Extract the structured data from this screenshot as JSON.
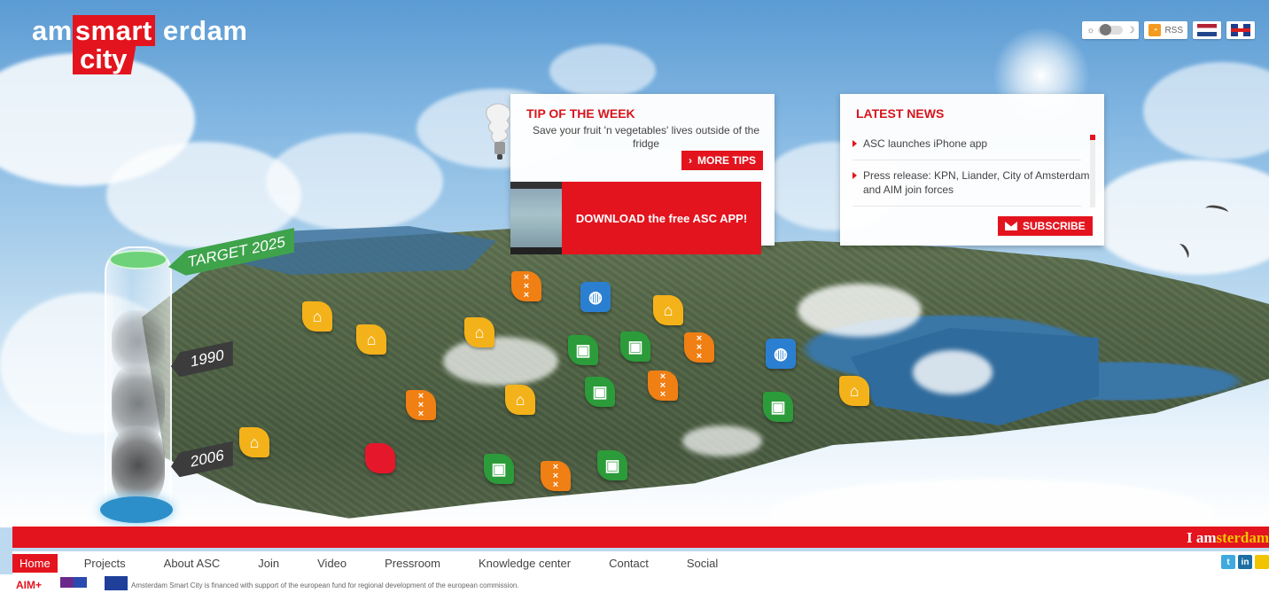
{
  "logo": {
    "part1": "am",
    "part2": "smart",
    "part3": "erdam",
    "part4": "city"
  },
  "top_controls": {
    "rss_label": "RSS"
  },
  "gauge": {
    "target_label": "TARGET 2025",
    "label_1990": "1990",
    "label_2006": "2006"
  },
  "tip": {
    "title": "TIP OF THE WEEK",
    "text": "Save your fruit 'n vegetables' lives outside of the fridge",
    "more_label": "MORE TIPS",
    "more_prefix": "›",
    "download_label": "DOWNLOAD the free ASC APP!"
  },
  "news": {
    "title": "LATEST NEWS",
    "items": [
      {
        "text": "ASC launches iPhone app"
      },
      {
        "text": "Press release: KPN, Liander, City of Amsterdam and AIM join forces"
      }
    ],
    "subscribe_label": "SUBSCRIBE"
  },
  "band": {
    "prefix": "I am",
    "highlight": "sterdam"
  },
  "nav": {
    "items": [
      "Home",
      "Projects",
      "About ASC",
      "Join",
      "Video",
      "Pressroom",
      "Knowledge center",
      "Contact",
      "Social"
    ]
  },
  "footer": {
    "aim": "AIM+",
    "text": "Amsterdam Smart City is financed with support of the european fund for regional development of the european commission."
  },
  "markers": [
    {
      "type": "home",
      "icon": "house-icon"
    },
    {
      "type": "job",
      "icon": "briefcase-icon"
    },
    {
      "type": "xxx",
      "icon": "amsterdam-xxx-icon"
    },
    {
      "type": "globe",
      "icon": "globe-icon"
    }
  ],
  "colors": {
    "brand_red": "#e3141e",
    "home": "#f4b21a",
    "job": "#2c9b3a",
    "xxx": "#f07f14",
    "globe": "#2b7fd1"
  }
}
